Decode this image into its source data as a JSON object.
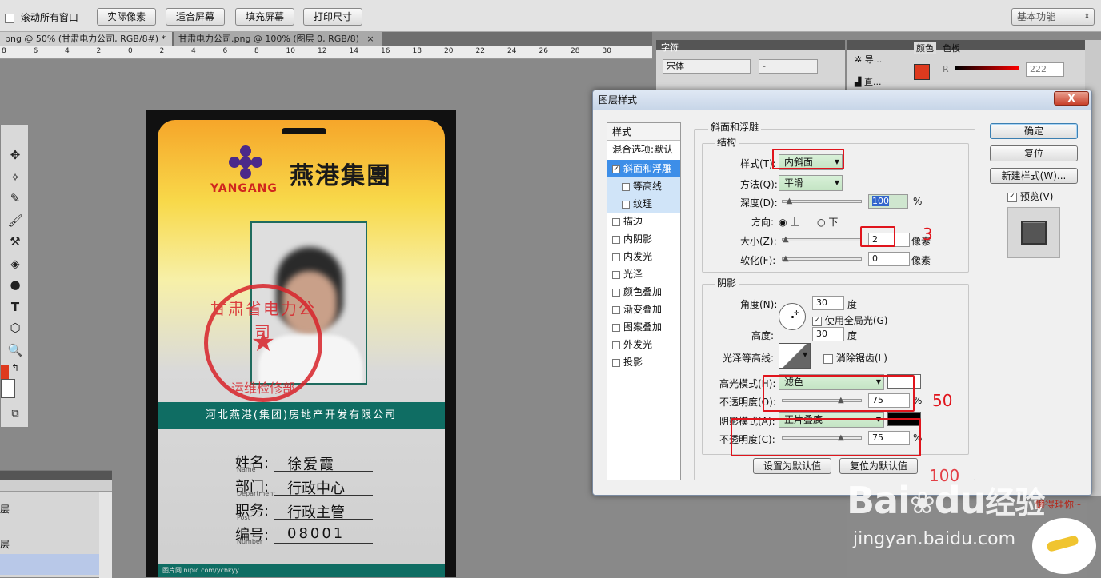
{
  "options_bar": {
    "scroll_all_label": "滚动所有窗口",
    "buttons": [
      "实际像素",
      "适合屏幕",
      "填充屏幕",
      "打印尺寸"
    ],
    "workspace": "基本功能"
  },
  "tabs": [
    {
      "label": "png @ 50% (甘肃电力公司, RGB/8#) *"
    },
    {
      "label": "甘肃电力公司.png @ 100% (图层 0, RGB/8)"
    }
  ],
  "ruler_ticks": [
    "8",
    "6",
    "4",
    "2",
    "0",
    "2",
    "4",
    "6",
    "8",
    "10",
    "12",
    "14",
    "16",
    "18",
    "20",
    "22",
    "24",
    "26",
    "28",
    "30"
  ],
  "layers_panel": {
    "rows": [
      "层",
      "层"
    ]
  },
  "char_panel": {
    "tab": "字符",
    "font": "宋体",
    "style": "-"
  },
  "nav_panel": {
    "items": [
      "导...",
      "直..."
    ]
  },
  "color_panel": {
    "tabs": [
      "颜色",
      "色板"
    ],
    "r_label": "R",
    "r_value": "222",
    "fg_color": "#de3a1e"
  },
  "card": {
    "company_logo_text": "YANGANG",
    "group_name": "燕港集團",
    "stamp_text": "甘肃省电力公司",
    "stamp_dept": "运维检修部",
    "company_banner": "河北燕港(集团)房地产开发有限公司",
    "fields": [
      {
        "label": "姓名:",
        "sub": "Name",
        "value": "徐爱霞"
      },
      {
        "label": "部门:",
        "sub": "Department",
        "value": "行政中心"
      },
      {
        "label": "职务:",
        "sub": "Post",
        "value": "行政主管"
      },
      {
        "label": "编号:",
        "sub": "Number",
        "value": "08001"
      }
    ],
    "footer_text": "图片网 nipic.com/ychkyy"
  },
  "dialog": {
    "title": "图层样式",
    "close": "X",
    "style_list": [
      {
        "label": "样式",
        "check": false
      },
      {
        "label": "混合选项:默认",
        "check": false
      },
      {
        "label": "斜面和浮雕",
        "check": true
      },
      {
        "label": "等高线",
        "check": false
      },
      {
        "label": "纹理",
        "check": false
      },
      {
        "label": "描边",
        "check": false
      },
      {
        "label": "内阴影",
        "check": false
      },
      {
        "label": "内发光",
        "check": false
      },
      {
        "label": "光泽",
        "check": false
      },
      {
        "label": "颜色叠加",
        "check": false
      },
      {
        "label": "渐变叠加",
        "check": false
      },
      {
        "label": "图案叠加",
        "check": false
      },
      {
        "label": "外发光",
        "check": false
      },
      {
        "label": "投影",
        "check": false
      }
    ],
    "bevel_title": "斜面和浮雕",
    "structure_title": "结构",
    "style_label": "样式(T):",
    "style_value": "内斜面",
    "method_label": "方法(Q):",
    "method_value": "平滑",
    "depth_label": "深度(D):",
    "depth_value": "100",
    "depth_unit": "%",
    "depth_fraction": 0.05,
    "direction_label": "方向:",
    "dir_up": "上",
    "dir_down": "下",
    "size_label": "大小(Z):",
    "size_value": "2",
    "size_unit": "像素",
    "size_fraction": 0.0,
    "soften_label": "软化(F):",
    "soften_value": "0",
    "soften_unit": "像素",
    "soften_fraction": 0.0,
    "shading_title": "阴影",
    "angle_label": "角度(N):",
    "angle_value": "30",
    "angle_unit": "度",
    "global_light": "使用全局光(G)",
    "altitude_label": "高度:",
    "altitude_value": "30",
    "altitude_unit": "度",
    "gloss_label": "光泽等高线:",
    "antialias": "消除锯齿(L)",
    "highlight_label": "高光模式(H):",
    "highlight_value": "滤色",
    "highlight_color": "#ffffff",
    "hl_opacity_label": "不透明度(O):",
    "hl_opacity_value": "75",
    "hl_opacity_fraction": 0.75,
    "pct": "%",
    "shadow_label": "阴影模式(A):",
    "shadow_value": "正片叠底",
    "shadow_color": "#000000",
    "sh_opacity_label": "不透明度(C):",
    "sh_opacity_value": "75",
    "sh_opacity_fraction": 0.75,
    "set_default": "设置为默认值",
    "reset_default": "复位为默认值",
    "ok": "确定",
    "reset": "复位",
    "new_style": "新建样式(W)...",
    "preview": "预览(V)"
  },
  "annotations": [
    "3",
    "50",
    "100"
  ],
  "watermark": {
    "main": "Bai",
    "paw": "du",
    "suffix": "经验",
    "url": "jingyan.baidu.com",
    "tagline": "懒得理你~"
  }
}
